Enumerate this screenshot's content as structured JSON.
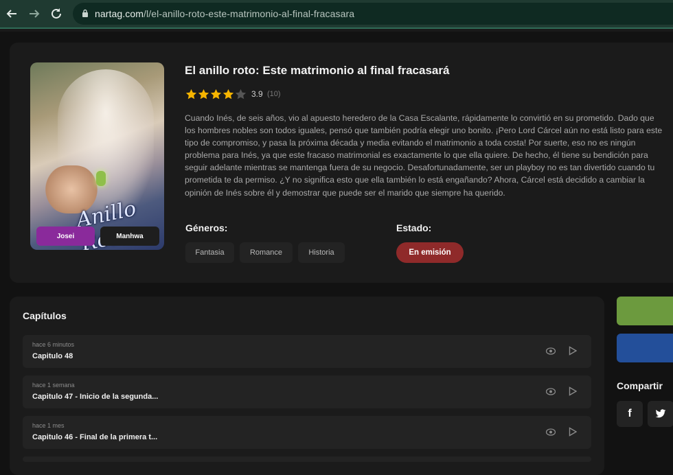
{
  "browser": {
    "url_domain": "nartag.com",
    "url_path": "/l/el-anillo-roto-este-matrimonio-al-final-fracasara"
  },
  "series": {
    "title": "El anillo roto: Este matrimonio al final fracasará",
    "rating": "3.9",
    "rating_count": "(10)",
    "stars": 4,
    "stars_max": 5,
    "synopsis": "Cuando Inés, de seis años, vio al apuesto heredero de la Casa Escalante, rápidamente lo convirtió en su prometido. Dado que los hombres nobles son todos iguales, pensó que también podría elegir uno bonito. ¡Pero Lord Cárcel aún no está listo para este tipo de compromiso, y pasa la próxima década y media evitando el matrimonio a toda costa! Por suerte, eso no es ningún problema para Inés, ya que este fracaso matrimonial es exactamente lo que ella quiere. De hecho, él tiene su bendición para seguir adelante mientras se mantenga fuera de su negocio. Desafortunadamente, ser un playboy no es tan divertido cuando tu prometida te da permiso. ¿Y no significa esto que ella también lo está engañando? Ahora, Cárcel está decidido a cambiar la opinión de Inés sobre él y demostrar que puede ser el marido que siempre ha querido.",
    "cover_logo": "Anillo Roto",
    "cover_tags": [
      "Josei",
      "Manhwa"
    ],
    "genres_label": "Géneros:",
    "genres": [
      "Fantasia",
      "Romance",
      "Historia"
    ],
    "status_label": "Estado:",
    "status": "En emisión"
  },
  "chapters": {
    "title": "Capítulos",
    "items": [
      {
        "time": "hace 6 minutos",
        "title": "Capitulo 48"
      },
      {
        "time": "hace 1 semana",
        "title": "Capitulo 47 - Inicio de la segunda..."
      },
      {
        "time": "hace 1 mes",
        "title": "Capitulo 46 - Final de la primera t..."
      }
    ]
  },
  "share": {
    "label": "Compartir",
    "facebook": "f",
    "twitter": "twitter-icon"
  },
  "colors": {
    "accent_green": "#6c9a3e",
    "accent_blue": "#234f9a",
    "josei_tag": "#8a2a9b",
    "status_red": "#8f2a2a",
    "star": "#f5b400"
  }
}
